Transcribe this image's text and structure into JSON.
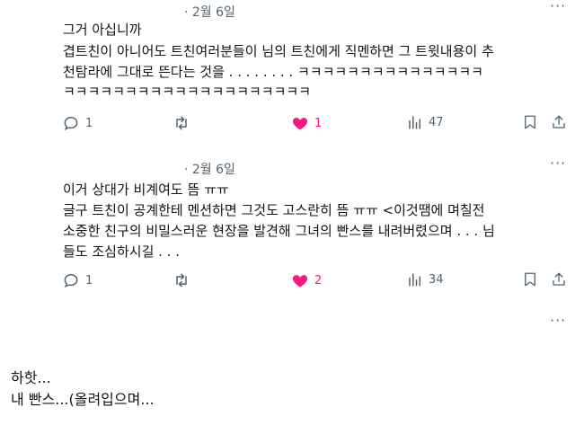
{
  "tweets": [
    {
      "date": "· 2월 6일",
      "lines": [
        "그거 아십니까",
        "겹트친이 아니어도 트친여러분들이 님의 트친에게 직멘하면 그 트윗내용이 추",
        "천탐라에 그대로 뜬다는 것을 . . . . . . . . ㅋㅋㅋㅋㅋㅋㅋㅋㅋㅋㅋㅋㅋㅋㅋ",
        "ㅋㅋㅋㅋㅋㅋㅋㅋㅋㅋㅋㅋㅋㅋㅋㅋㅋㅋㅋㅋ"
      ],
      "reply_count": "1",
      "retweet_count": "",
      "like_count": "1",
      "view_count": "47"
    },
    {
      "date": "· 2월 6일",
      "lines": [
        "이거 상대가 비계여도 뜸 ㅠㅠ",
        "글구 트친이 공계한테 멘션하면 그것도 고스란히 뜸 ㅠㅠ <이것땜에 며칠전",
        "소중한 친구의 비밀스러운 현장을 발견해 그녀의 빤스를 내려버렸으며 . . . 님",
        "들도 조심하시길 . . ."
      ],
      "reply_count": "1",
      "retweet_count": "",
      "like_count": "2",
      "view_count": "34"
    }
  ],
  "more_label": "···",
  "footer_lines": [
    "하핫...",
    "내 빤스...(올려입으며..."
  ],
  "colors": {
    "like": "#f91880",
    "icon": "#536471",
    "text": "#0f1419"
  }
}
